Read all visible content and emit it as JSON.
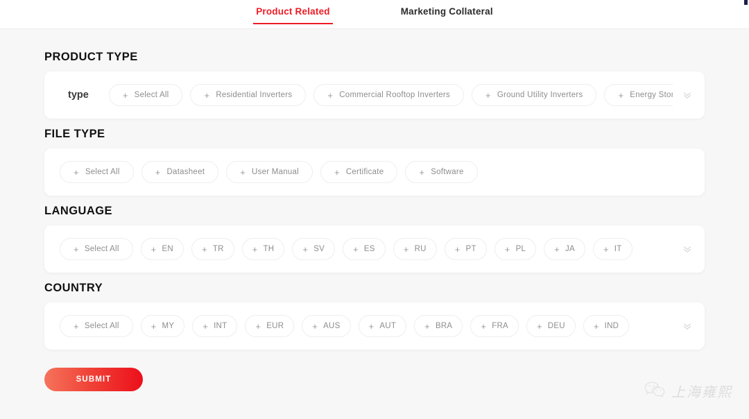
{
  "tabs": [
    {
      "label": "Product Related",
      "active": true
    },
    {
      "label": "Marketing Collateral",
      "active": false
    }
  ],
  "accent_color": "#ee1b24",
  "sections": [
    {
      "title": "PRODUCT TYPE",
      "row_label": "type",
      "has_expand": true,
      "expand_icon": "double-chevron-down-icon",
      "chips": [
        {
          "label": "Select All",
          "icon": "plus-icon"
        },
        {
          "label": "Residential Inverters",
          "icon": "plus-icon"
        },
        {
          "label": "Commercial Rooftop Inverters",
          "icon": "plus-icon"
        },
        {
          "label": "Ground Utility Inverters",
          "icon": "plus-icon"
        },
        {
          "label": "Energy Storage Inverters",
          "icon": "plus-icon"
        }
      ]
    },
    {
      "title": "FILE TYPE",
      "row_label": "",
      "has_expand": false,
      "expand_icon": "",
      "chips": [
        {
          "label": "Select All",
          "icon": "plus-icon"
        },
        {
          "label": "Datasheet",
          "icon": "plus-icon"
        },
        {
          "label": "User Manual",
          "icon": "plus-icon"
        },
        {
          "label": "Certificate",
          "icon": "plus-icon"
        },
        {
          "label": "Software",
          "icon": "plus-icon"
        }
      ]
    },
    {
      "title": "LANGUAGE",
      "row_label": "",
      "has_expand": true,
      "expand_icon": "double-chevron-down-icon",
      "chips": [
        {
          "label": "Select All",
          "icon": "plus-icon"
        },
        {
          "label": "EN",
          "icon": "plus-icon"
        },
        {
          "label": "TR",
          "icon": "plus-icon"
        },
        {
          "label": "TH",
          "icon": "plus-icon"
        },
        {
          "label": "SV",
          "icon": "plus-icon"
        },
        {
          "label": "ES",
          "icon": "plus-icon"
        },
        {
          "label": "RU",
          "icon": "plus-icon"
        },
        {
          "label": "PT",
          "icon": "plus-icon"
        },
        {
          "label": "PL",
          "icon": "plus-icon"
        },
        {
          "label": "JA",
          "icon": "plus-icon"
        },
        {
          "label": "IT",
          "icon": "plus-icon"
        }
      ]
    },
    {
      "title": "COUNTRY",
      "row_label": "",
      "has_expand": true,
      "expand_icon": "double-chevron-down-icon",
      "chips": [
        {
          "label": "Select All",
          "icon": "plus-icon"
        },
        {
          "label": "MY",
          "icon": "plus-icon"
        },
        {
          "label": "INT",
          "icon": "plus-icon"
        },
        {
          "label": "EUR",
          "icon": "plus-icon"
        },
        {
          "label": "AUS",
          "icon": "plus-icon"
        },
        {
          "label": "AUT",
          "icon": "plus-icon"
        },
        {
          "label": "BRA",
          "icon": "plus-icon"
        },
        {
          "label": "FRA",
          "icon": "plus-icon"
        },
        {
          "label": "DEU",
          "icon": "plus-icon"
        },
        {
          "label": "IND",
          "icon": "plus-icon"
        }
      ]
    }
  ],
  "submit": {
    "label": "SUBMIT"
  },
  "watermark": {
    "text": "上海雍熙",
    "icon": "wechat-icon"
  }
}
